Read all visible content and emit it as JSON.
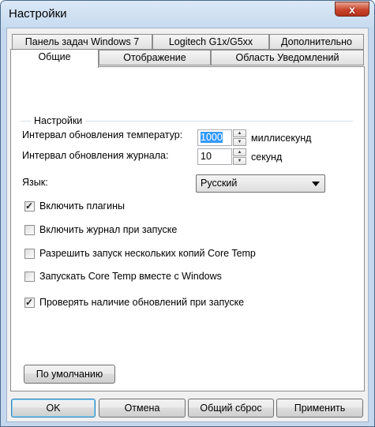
{
  "window": {
    "title": "Настройки",
    "close_glyph": "x"
  },
  "tabs": {
    "row1": [
      "Панель задач Windows 7",
      "Logitech G1x/G5xx",
      "Дополнительно"
    ],
    "row2": [
      "Общие",
      "Отображение",
      "Область Уведомлений"
    ]
  },
  "group": {
    "label": "Настройки"
  },
  "settings": {
    "temp_interval_label": "Интервал обновления температур:",
    "temp_interval_value": "1000",
    "temp_interval_unit": "миллисекунд",
    "log_interval_label": "Интервал обновления журнала:",
    "log_interval_value": "10",
    "log_interval_unit": "секунд",
    "language_label": "Язык:",
    "language_value": "Русский"
  },
  "checkboxes": [
    {
      "label": "Включить плагины",
      "checked": true
    },
    {
      "label": "Включить журнал при запуске",
      "checked": false
    },
    {
      "label": "Разрешить запуск нескольких копий Core Temp",
      "checked": false
    },
    {
      "label": "Запускать Core Temp вместе с Windows",
      "checked": false
    },
    {
      "label": "Проверять наличие обновлений при запуске",
      "checked": true
    }
  ],
  "buttons": {
    "defaults": "По умолчанию",
    "ok": "OK",
    "cancel": "Отмена",
    "reset": "Общий сброс",
    "apply": "Применить"
  }
}
